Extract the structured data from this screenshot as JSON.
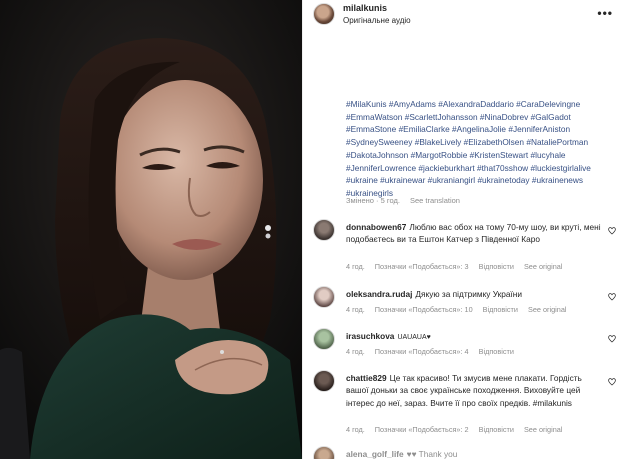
{
  "header": {
    "username": "milalkunis",
    "audio_label": "Оригінальне аудіо",
    "more_icon": "more-icon"
  },
  "post": {
    "caption": "#MilaKunis #AmyAdams #AlexandraDaddario #CaraDelevingne #EmmaWatson #ScarlettJohansson #NinaDobrev #GalGadot #EmmaStone #EmiliaClarke #AngelinaJolie #JenniferAniston #SydneySweeney #BlakeLively #ElizabethOlsen #NataliePortman #DakotaJohnson #MargotRobbie #KristenStewart #lucyhale #JenniferLowrence #jackieburkhart #that70sshow #luckiestgirlalive #ukraine #ukrainewar #ukraniangirl #ukrainetoday #ukrainenews #ukrainegirls",
    "edited": "Змінено · 5 год.",
    "see_translation": "See translation"
  },
  "comments": [
    {
      "user": "donnabowen67",
      "text": "Люблю вас обох на тому 70-му шоу, ви круті, мені подобаєтесь ви та Ештон Катчер з Південної Каро",
      "age": "4 год.",
      "likes": "Позначки «Подобається»: 3",
      "reply": "Відповісти",
      "see_original": "See original"
    },
    {
      "user": "oleksandra.rudaj",
      "text": "Дякую за підтримку України",
      "age": "4 год.",
      "likes": "Позначки «Подобається»: 10",
      "reply": "Відповісти",
      "see_original": "See original"
    },
    {
      "user": "irasuchkova",
      "text": "UAUAUA♥",
      "age": "4 год.",
      "likes": "Позначки «Подобається»: 4",
      "reply": "Відповісти",
      "see_original": ""
    },
    {
      "user": "chattie829",
      "text": "Це так красиво! Ти змусив мене плакати. Гордість вашої доньки за своє українське походження. Виховуйте цей інтерес до неї, зараз. Вчите її про своїх предків. #milakunis",
      "age": "4 год.",
      "likes": "Позначки «Подобається»: 2",
      "reply": "Відповісти",
      "see_original": "See original"
    },
    {
      "user": "alena_golf_life",
      "text": "♥♥ Thank you",
      "age": "",
      "likes": "",
      "reply": "",
      "see_original": ""
    }
  ],
  "colors": {
    "hashtag": "#385185",
    "meta": "#8e8e8e",
    "text": "#262626",
    "heart_outline": "#262626"
  }
}
